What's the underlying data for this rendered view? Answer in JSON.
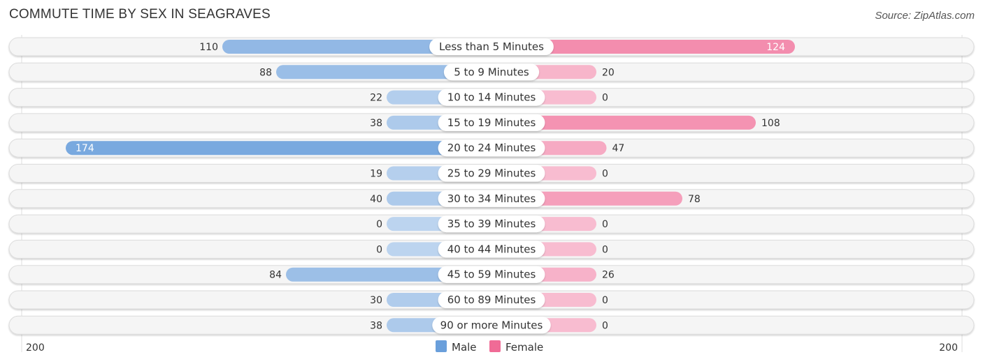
{
  "header": {
    "title": "COMMUTE TIME BY SEX IN SEAGRAVES",
    "source": "Source: ZipAtlas.com"
  },
  "chart_data": {
    "type": "bar",
    "orientation": "horizontal-diverging",
    "title": "COMMUTE TIME BY SEX IN SEAGRAVES",
    "categories": [
      "Less than 5 Minutes",
      "5 to 9 Minutes",
      "10 to 14 Minutes",
      "15 to 19 Minutes",
      "20 to 24 Minutes",
      "25 to 29 Minutes",
      "30 to 34 Minutes",
      "35 to 39 Minutes",
      "40 to 44 Minutes",
      "45 to 59 Minutes",
      "60 to 89 Minutes",
      "90 or more Minutes"
    ],
    "series": [
      {
        "name": "Male",
        "color": "#6a9fdb",
        "values": [
          110,
          88,
          22,
          38,
          174,
          19,
          40,
          0,
          0,
          84,
          30,
          38
        ]
      },
      {
        "name": "Female",
        "color": "#f06b96",
        "values": [
          124,
          20,
          0,
          108,
          47,
          0,
          78,
          0,
          0,
          26,
          0,
          0
        ]
      }
    ],
    "axis": {
      "left_label": "200",
      "right_label": "200",
      "range": [
        -200,
        200
      ]
    },
    "legend": {
      "position": "bottom-center",
      "entries": [
        "Male",
        "Female"
      ]
    }
  }
}
